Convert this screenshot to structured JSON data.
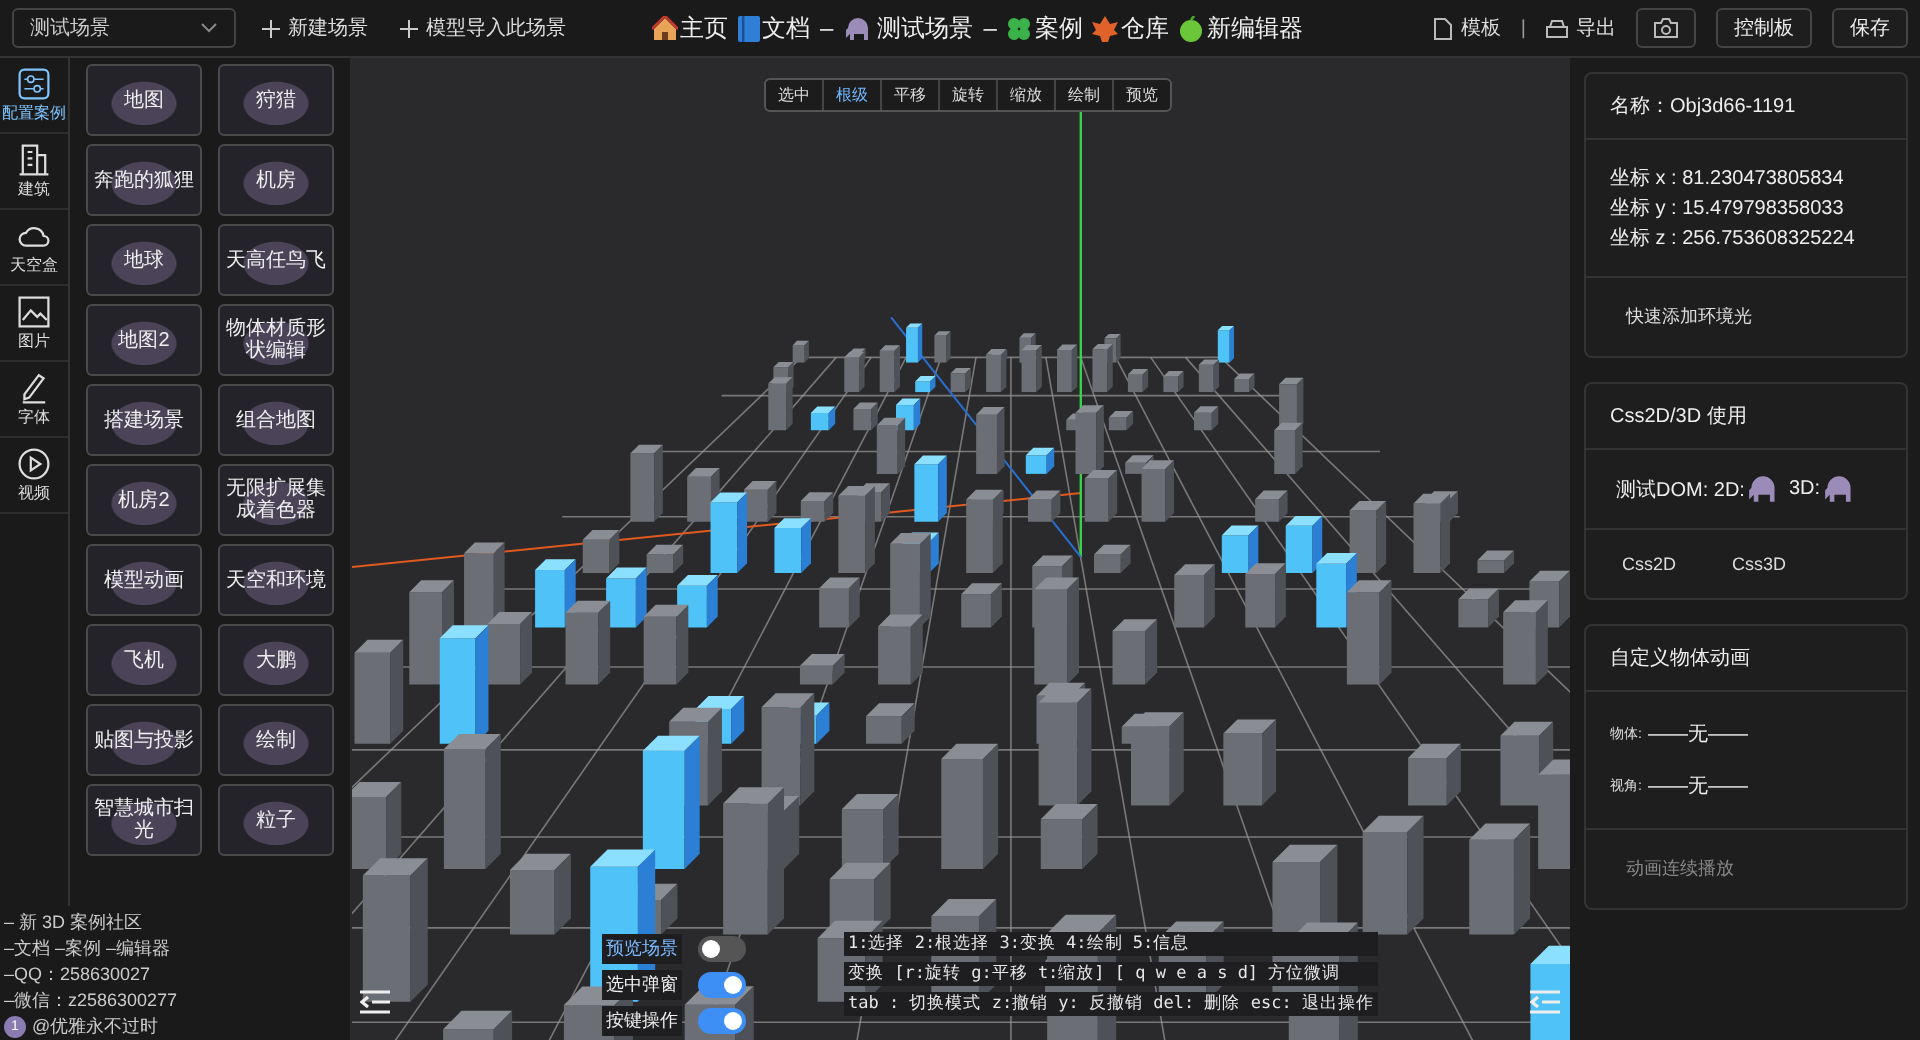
{
  "scene_select": {
    "value": "测试场景"
  },
  "actions": [
    {
      "label": "新建场景"
    },
    {
      "label": "模型导入此场景"
    }
  ],
  "nav": [
    {
      "kind": "link",
      "label": "主页"
    },
    {
      "kind": "link",
      "label": "文档"
    },
    {
      "kind": "dash",
      "label": "–"
    },
    {
      "kind": "title",
      "label": "测试场景"
    },
    {
      "kind": "dash",
      "label": "–"
    },
    {
      "kind": "link",
      "label": "案例"
    },
    {
      "kind": "link",
      "label": "仓库"
    },
    {
      "kind": "link",
      "label": "新编辑器"
    }
  ],
  "tools": [
    {
      "kind": "link",
      "label": "模板"
    },
    {
      "kind": "divider",
      "label": "|"
    },
    {
      "kind": "link",
      "label": "导出"
    },
    {
      "kind": "button"
    },
    {
      "kind": "button",
      "label": "控制板"
    },
    {
      "kind": "button",
      "label": "保存"
    }
  ],
  "sidebar": {
    "items": [
      {
        "label": "配置案例",
        "selected": true
      },
      {
        "label": "建筑",
        "selected": false
      },
      {
        "label": "天空盒",
        "selected": false
      },
      {
        "label": "图片",
        "selected": false
      },
      {
        "label": "字体",
        "selected": false
      },
      {
        "label": "视频",
        "selected": false
      }
    ]
  },
  "cases": [
    "地图",
    "狩猎",
    "奔跑的狐狸",
    "机房",
    "地球",
    "天高任鸟飞",
    "地图2",
    "物体材质形状编辑",
    "搭建场景",
    "组合地图",
    "机房2",
    "无限扩展集成着色器",
    "模型动画",
    "天空和环境",
    "飞机",
    "大鹏",
    "贴图与投影",
    "绘制",
    "智慧城市扫光",
    "粒子"
  ],
  "community": {
    "lines": [
      "– 新 3D 案例社区",
      "–文档 –案例 –编辑器",
      "–QQ：258630027",
      "–微信：z2586300277"
    ],
    "user": {
      "badge": "1",
      "name": "@优雅永不过时"
    }
  },
  "modes": [
    {
      "label": "选中",
      "selected": false
    },
    {
      "label": "根级",
      "selected": true
    },
    {
      "label": "平移",
      "selected": false
    },
    {
      "label": "旋转",
      "selected": false
    },
    {
      "label": "缩放",
      "selected": false
    },
    {
      "label": "绘制",
      "selected": false
    },
    {
      "label": "预览",
      "selected": false
    }
  ],
  "toggles": [
    {
      "label": "预览场景",
      "on": false,
      "highlighted": true
    },
    {
      "label": "选中弹窗",
      "on": true,
      "highlighted": false
    },
    {
      "label": "按键操作",
      "on": true,
      "highlighted": false
    }
  ],
  "help": [
    "1:选择 2:根选择 3:变换 4:绘制 5:信息",
    "变换 [r:旋转 g:平移 t:缩放] [ q w e a s d] 方位微调",
    "tab : 切换模式 z:撤销 y: 反撤销 del: 删除 esc: 退出操作"
  ],
  "object_panel": {
    "name_label": "名称：",
    "name": "Obj3d66-1191",
    "coords": [
      "坐标 x : 81.230473805834",
      "坐标 y : 15.479798358033",
      "坐标 z : 256.753608325224"
    ],
    "button": "快速添加环境光"
  },
  "css_panel": {
    "title": "Css2D/3D 使用",
    "dom_label": "测试DOM: 2D:",
    "dom_3d": "3D:",
    "buttons": [
      "Css2D",
      "Css3D"
    ]
  },
  "anim_panel": {
    "title": "自定义物体动画",
    "fields": [
      {
        "label": "物体:",
        "value": "——无——"
      },
      {
        "label": "视角:",
        "value": "——无——"
      }
    ],
    "button": {
      "label": "动画连续播放",
      "disabled": true
    }
  }
}
